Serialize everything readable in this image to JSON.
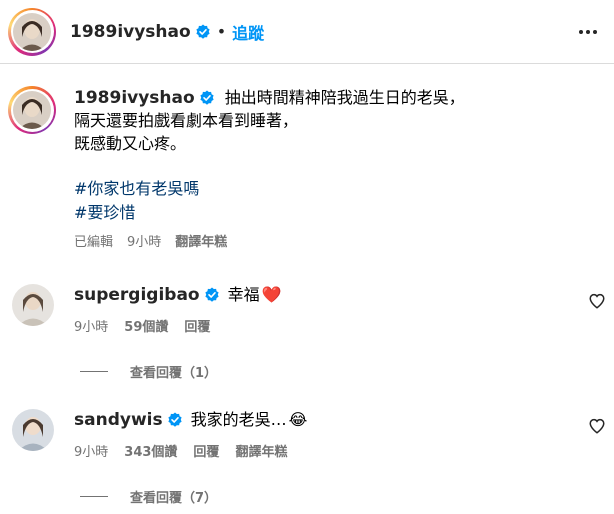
{
  "header": {
    "username": "1989ivyshao",
    "separator": "•",
    "follow_label": "追蹤",
    "more_icon": "more-horizontal-icon"
  },
  "caption": {
    "username": "1989ivyshao",
    "lines": [
      "抽出時間精神陪我過生日的老吳，",
      "隔天還要拍戲看劇本看到睡著，",
      "既感動又心疼。"
    ],
    "hashtags": [
      "#你家也有老吳嗎",
      "#要珍惜"
    ],
    "edited": "已編輯",
    "time": "9小時",
    "translate": "翻譯年糕"
  },
  "comments": [
    {
      "username": "supergigibao",
      "text": "幸福",
      "emoji": "❤️",
      "time": "9小時",
      "likes": "59個讚",
      "reply": "回覆",
      "translate": "",
      "view_replies": "查看回覆（1）"
    },
    {
      "username": "sandywis",
      "text": "我家的老吳…",
      "emoji": "😂",
      "time": "9小時",
      "likes": "343個讚",
      "reply": "回覆",
      "translate": "翻譯年糕",
      "view_replies": "查看回覆（7）"
    }
  ],
  "colors": {
    "link_blue": "#0095f6",
    "hashtag_blue": "#00376b",
    "muted": "#737373",
    "verified_blue": "#0095f6"
  }
}
